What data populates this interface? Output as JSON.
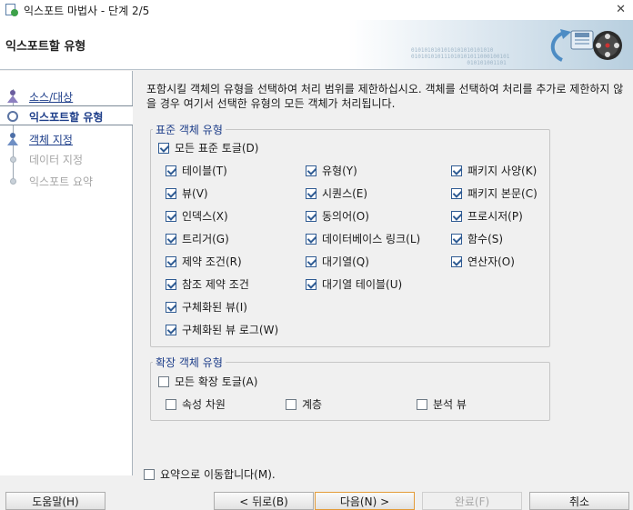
{
  "window": {
    "title": "익스포트 마법사 - 단계 2/5",
    "close_glyph": "✕"
  },
  "header": {
    "title": "익스포트할 유형",
    "binary_text": "0101010101010101010101010\n010101010111010101011000100101\n                 010101001101"
  },
  "sidebar": {
    "steps": [
      {
        "label": "소스/대상",
        "state": "link",
        "icon": "person-icon"
      },
      {
        "label": "익스포트할 유형",
        "state": "active",
        "icon": "current-step-icon"
      },
      {
        "label": "객체 지정",
        "state": "link",
        "icon": "person-icon"
      },
      {
        "label": "데이터 지정",
        "state": "disabled",
        "icon": "step-dot-icon"
      },
      {
        "label": "익스포트 요약",
        "state": "disabled",
        "icon": "step-dot-icon"
      }
    ]
  },
  "main": {
    "intro": "포함시킬 객체의 유형을 선택하여 처리 범위를 제한하십시오. 객체를 선택하여 처리를 추가로 제한하지 않을 경우 여기서 선택한 유형의 모든 객체가 처리됩니다.",
    "standard": {
      "legend": "표준 객체 유형",
      "toggle_all": {
        "label": "모든 표준 토글(D)",
        "checked": true
      },
      "items": [
        {
          "label": "테이블(T)",
          "checked": true
        },
        {
          "label": "유형(Y)",
          "checked": true
        },
        {
          "label": "패키지 사양(K)",
          "checked": true
        },
        {
          "label": "뷰(V)",
          "checked": true
        },
        {
          "label": "시퀀스(E)",
          "checked": true
        },
        {
          "label": "패키지 본문(C)",
          "checked": true
        },
        {
          "label": "인덱스(X)",
          "checked": true
        },
        {
          "label": "동의어(O)",
          "checked": true
        },
        {
          "label": "프로시저(P)",
          "checked": true
        },
        {
          "label": "트리거(G)",
          "checked": true
        },
        {
          "label": "데이터베이스 링크(L)",
          "checked": true
        },
        {
          "label": "함수(S)",
          "checked": true
        },
        {
          "label": "제약 조건(R)",
          "checked": true
        },
        {
          "label": "대기열(Q)",
          "checked": true
        },
        {
          "label": "연산자(O)",
          "checked": true
        },
        {
          "label": "참조 제약 조건",
          "checked": true
        },
        {
          "label": "대기열 테이블(U)",
          "checked": true
        },
        {
          "label": "구체화된 뷰(I)",
          "checked": true
        },
        {
          "label": "구체화된 뷰 로그(W)",
          "checked": true
        }
      ]
    },
    "extended": {
      "legend": "확장 객체 유형",
      "toggle_all": {
        "label": "모든 확장 토글(A)",
        "checked": false
      },
      "items": [
        {
          "label": "속성 차원",
          "checked": false
        },
        {
          "label": "계층",
          "checked": false
        },
        {
          "label": "분석 뷰",
          "checked": false
        }
      ]
    },
    "go_to_summary": {
      "label": "요약으로 이동합니다(M).",
      "checked": false
    }
  },
  "footer": {
    "help": "도움말(H)",
    "back": "< 뒤로(B)",
    "next": "다음(N) >",
    "finish": "완료(F)",
    "cancel": "취소"
  },
  "colors": {
    "link": "#1f3f8a",
    "check": "#2f5b93",
    "primary_border": "#e39b38"
  }
}
